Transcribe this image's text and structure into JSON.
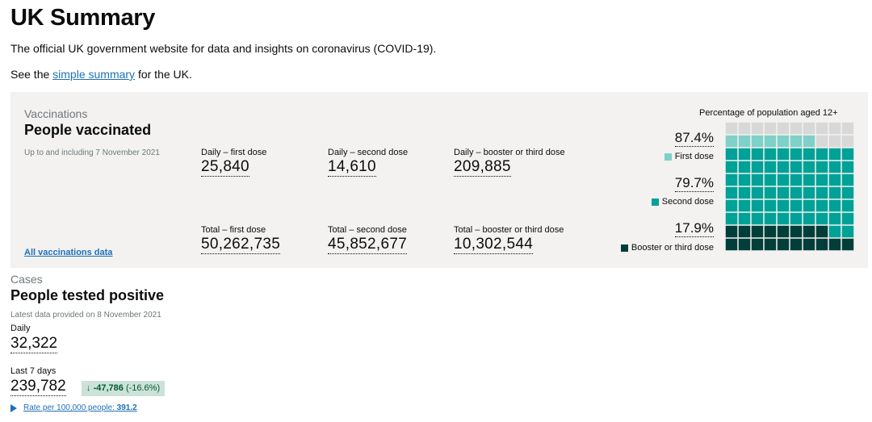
{
  "page": {
    "title": "UK Summary",
    "intro": "The official UK government website for data and insights on coronavirus (COVID-19).",
    "simple_prefix": "See the",
    "simple_link": "simple summary",
    "simple_suffix": "for the UK."
  },
  "vaccinations": {
    "category": "Vaccinations",
    "title": "People vaccinated",
    "date": "Up to and including 7 November 2021",
    "daily_first_label": "Daily – first dose",
    "daily_first_value": "25,840",
    "daily_second_label": "Daily – second dose",
    "daily_second_value": "14,610",
    "daily_booster_label": "Daily – booster or third dose",
    "daily_booster_value": "209,885",
    "total_first_label": "Total – first dose",
    "total_first_value": "50,262,735",
    "total_second_label": "Total – second dose",
    "total_second_value": "45,852,677",
    "total_booster_label": "Total – booster or third dose",
    "total_booster_value": "10,302,544",
    "link": "All vaccinations data",
    "chart_caption": "Percentage of population aged 12+",
    "first_pct": "87.4%",
    "first_label": "First dose",
    "second_pct": "79.7%",
    "second_label": "Second dose",
    "booster_pct": "17.9%",
    "booster_label": "Booster or third dose"
  },
  "chart_data": {
    "type": "waffle",
    "title": "Percentage of population aged 12+",
    "total_cells": 100,
    "series": [
      {
        "name": "First dose",
        "value": 87.4,
        "color": "#7fd0c8"
      },
      {
        "name": "Second dose",
        "value": 79.7,
        "color": "#00a197"
      },
      {
        "name": "Booster or third dose",
        "value": 17.9,
        "color": "#013e3a"
      }
    ],
    "empty_color": "#d8d8d8"
  },
  "cases": {
    "category": "Cases",
    "title": "People tested positive",
    "date": "Latest data provided on 8 November 2021",
    "daily_label": "Daily",
    "daily_value": "32,322",
    "week_label": "Last 7 days",
    "week_value": "239,782",
    "change_arrow": "↓",
    "change_value": "-47,786",
    "change_pct": "(-16.6%)",
    "rate_label": "Rate per 100,000 people:",
    "rate_value": "391.2"
  }
}
